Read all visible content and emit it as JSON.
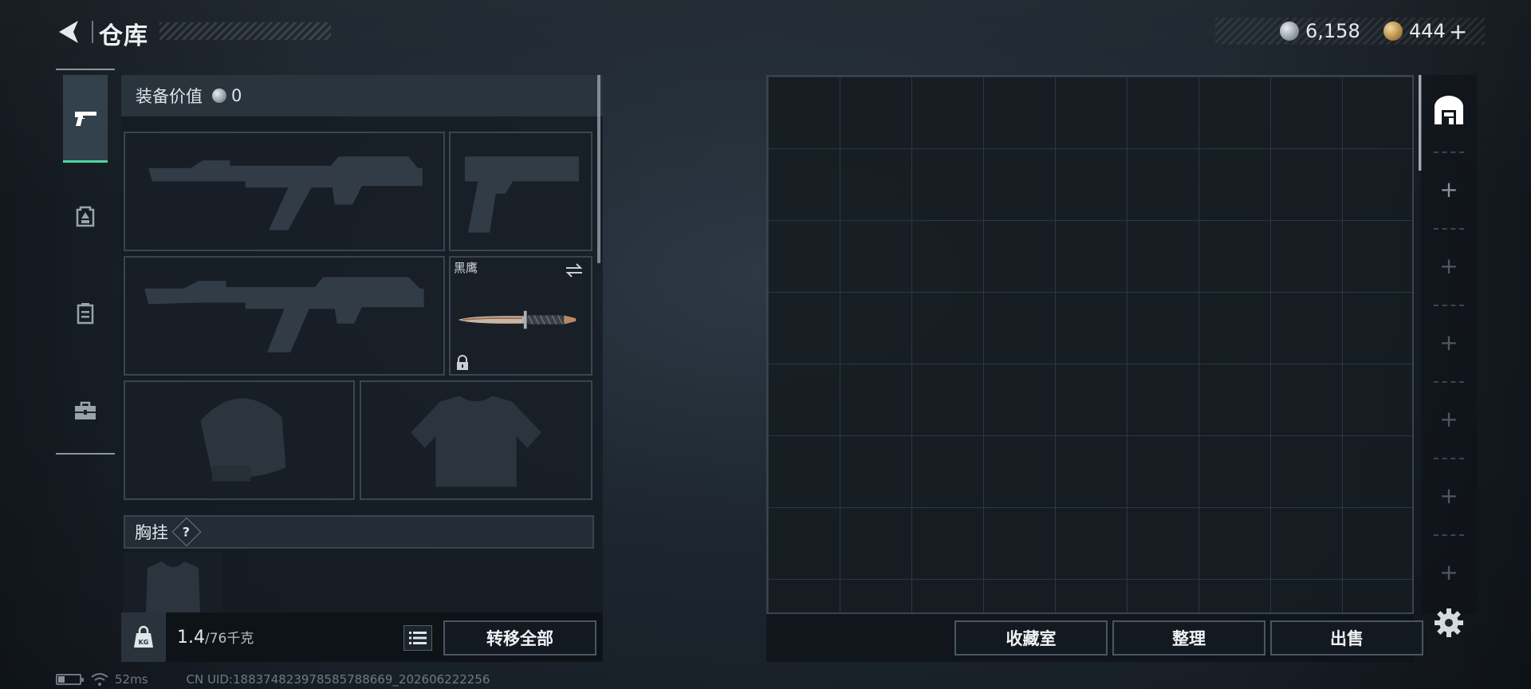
{
  "header": {
    "title": "仓库",
    "currency_silver": "6,158",
    "currency_gold": "444",
    "plus_symbol": "+"
  },
  "left_tabs": [
    {
      "name": "weapons",
      "icon": "pistol-icon",
      "active": true
    },
    {
      "name": "backpack",
      "icon": "backpack-icon",
      "active": false
    },
    {
      "name": "container",
      "icon": "container-icon",
      "active": false
    },
    {
      "name": "toolbox",
      "icon": "toolbox-icon",
      "active": false
    }
  ],
  "loadout": {
    "value_label": "装备价值",
    "value": "0",
    "melee_slot_label": "黑鹰",
    "chest_rig_label": "胸挂",
    "help_symbol": "?"
  },
  "weight": {
    "kg_label": "KG",
    "current": "1.4",
    "max": "/76千克"
  },
  "buttons": {
    "transfer_all": "转移全部",
    "collection_room": "收藏室",
    "organize": "整理",
    "sell": "出售"
  },
  "status": {
    "ping": "52ms",
    "uid": "CN UID:1883748239785857886​69_202606222256"
  },
  "colors": {
    "accent": "#4fd6a4",
    "panel_bg": "#181f27",
    "border": "#3a4550"
  }
}
